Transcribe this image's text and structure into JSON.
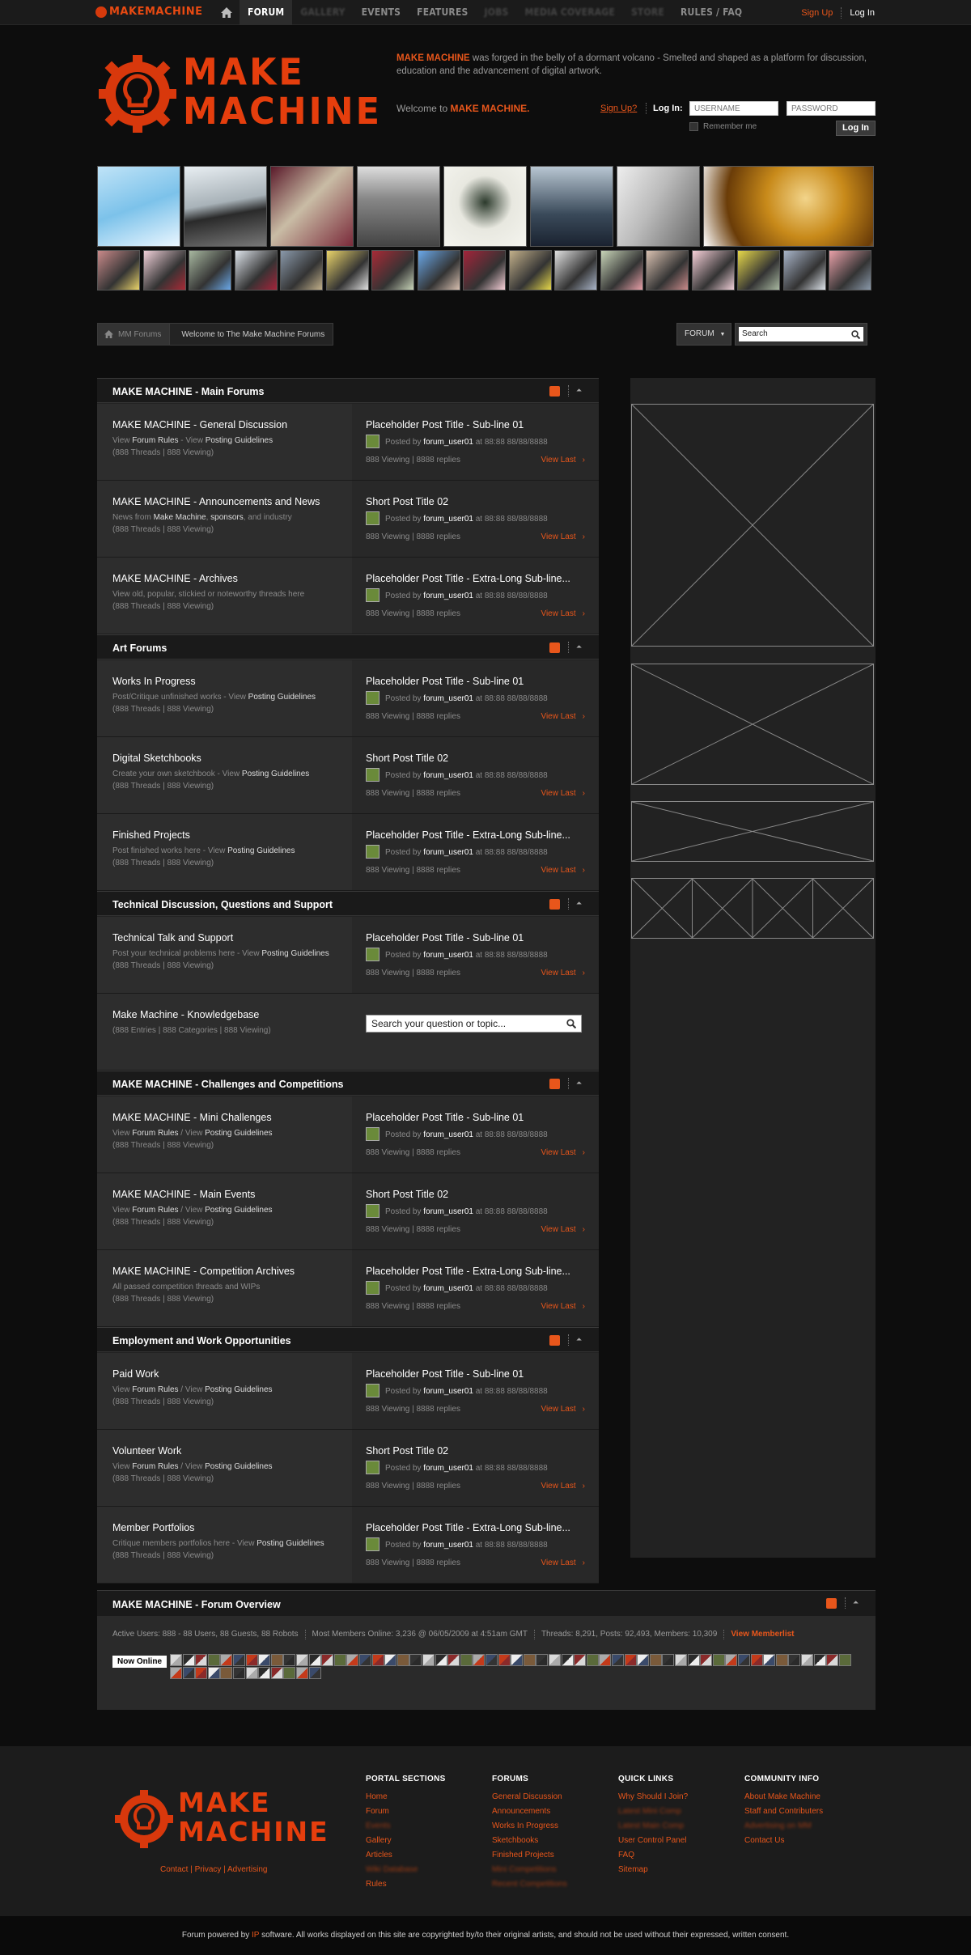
{
  "topnav": {
    "logo_text": "MAKEMACHINE",
    "items": [
      {
        "label": "FORUM",
        "active": true
      },
      {
        "label": "GALLERY",
        "blur": true
      },
      {
        "label": "EVENTS"
      },
      {
        "label": "FEATURES"
      },
      {
        "label": "JOBS",
        "blur": true
      },
      {
        "label": "MEDIA COVERAGE",
        "blur": true
      },
      {
        "label": "STORE",
        "blur": true
      },
      {
        "label": "RULES / FAQ"
      }
    ],
    "signup": "Sign Up",
    "login": "Log In"
  },
  "header": {
    "logo_line1": "MAKE",
    "logo_line2": "MACHINE",
    "intro_brand": "MAKE MACHINE",
    "intro_text": " was forged in the belly of a dormant volcano - Smelted and shaped as a platform for discussion, education and the advancement of digital artwork.",
    "welcome_prefix": "Welcome to ",
    "welcome_brand": "MAKE MACHINE."
  },
  "login": {
    "signup": "Sign Up?",
    "label": "Log In:",
    "username_placeholder": "USERNAME",
    "password_placeholder": "PASSWORD",
    "remember": "Remember me",
    "button": "Log In"
  },
  "breadcrumb": {
    "home": "MM Forums",
    "current": "Welcome to The Make Machine Forums"
  },
  "forum_search": {
    "dropdown": "FORUM",
    "placeholder": "Search"
  },
  "categories": [
    {
      "title": "MAKE MACHINE - Main Forums"
    },
    {
      "title": "Art Forums"
    },
    {
      "title": "Technical Discussion, Questions and Support"
    },
    {
      "title": "MAKE MACHINE - Challenges and Competitions"
    },
    {
      "title": "Employment and Work Opportunities"
    }
  ],
  "forums": [
    {
      "title": "MAKE MACHINE - General Discussion",
      "desc_a": "View ",
      "desc_b": "Forum Rules",
      "desc_c": " - View ",
      "desc_d": "Posting Guidelines",
      "stats": "(888 Threads | 888 Viewing)",
      "post": "Placeholder Post Title - Sub-line 01"
    },
    {
      "title": "MAKE MACHINE - Announcements and News",
      "desc_a": "News from ",
      "desc_b": "Make Machine",
      "desc_c": ", ",
      "desc_d": "sponsors",
      "desc_e": ", and industry",
      "stats": "(888 Threads | 888 Viewing)",
      "post": "Short Post Title 02"
    },
    {
      "title": "MAKE MACHINE - Archives",
      "desc_a": "View old, popular, stickied or noteworthy threads here",
      "stats": "(888 Threads | 888 Viewing)",
      "post": "Placeholder Post Title - Extra-Long Sub-line..."
    },
    {
      "title": "Works In Progress",
      "desc_a": "Post/Critique unfinished works - View ",
      "desc_d": "Posting Guidelines",
      "stats": "(888 Threads | 888 Viewing)",
      "post": "Placeholder Post Title - Sub-line 01"
    },
    {
      "title": "Digital Sketchbooks",
      "desc_a": "Create your own sketchbook - View ",
      "desc_d": "Posting Guidelines",
      "stats": "(888 Threads | 888 Viewing)",
      "post": "Short Post Title 02"
    },
    {
      "title": "Finished Projects",
      "desc_a": "Post finished works here - View ",
      "desc_d": "Posting Guidelines",
      "stats": "(888 Threads | 888 Viewing)",
      "post": "Placeholder Post Title - Extra-Long Sub-line..."
    },
    {
      "title": "Technical Talk and Support",
      "desc_a": "Post your technical problems here - View ",
      "desc_d": "Posting Guidelines",
      "stats": "(888 Threads | 888 Viewing)",
      "post": "Placeholder Post Title - Sub-line 01"
    },
    {
      "title": "Make Machine - Knowledgebase",
      "stats": "(888 Entries | 888 Categories | 888 Viewing)",
      "kb_placeholder": "Search your question or topic..."
    },
    {
      "title": "MAKE MACHINE - Mini Challenges",
      "desc_a": "View ",
      "desc_b": "Forum Rules",
      "desc_c": " / View ",
      "desc_d": "Posting Guidelines",
      "stats": "(888 Threads | 888 Viewing)",
      "post": "Placeholder Post Title - Sub-line 01"
    },
    {
      "title": "MAKE MACHINE - Main Events",
      "desc_a": "View ",
      "desc_b": "Forum Rules",
      "desc_c": " / View ",
      "desc_d": "Posting Guidelines",
      "stats": "(888 Threads | 888 Viewing)",
      "post": "Short Post Title 02"
    },
    {
      "title": "MAKE MACHINE - Competition Archives",
      "desc_a": "All passed competition threads and WIPs",
      "stats": "(888 Threads | 888 Viewing)",
      "post": "Placeholder Post Title - Extra-Long Sub-line..."
    },
    {
      "title": "Paid Work",
      "desc_a": "View ",
      "desc_b": "Forum Rules",
      "desc_c": " / View ",
      "desc_d": "Posting Guidelines",
      "stats": "(888 Threads | 888 Viewing)",
      "post": "Placeholder Post Title - Sub-line 01"
    },
    {
      "title": "Volunteer Work",
      "desc_a": "View ",
      "desc_b": "Forum Rules",
      "desc_c": " / View ",
      "desc_d": "Posting Guidelines",
      "stats": "(888 Threads | 888 Viewing)",
      "post": "Short Post Title 02"
    },
    {
      "title": "Member Portfolios",
      "desc_a": "Critique members portfolios here - View ",
      "desc_d": "Posting Guidelines",
      "stats": "(888 Threads | 888 Viewing)",
      "post": "Placeholder Post Title - Extra-Long Sub-line..."
    }
  ],
  "post_meta": {
    "posted_by": "Posted by ",
    "user": "forum_user01",
    "at": " at 88:88 88/88/8888",
    "viewing": "888 Viewing | 8888 replies",
    "view_last": "View Last",
    "arrow": "›"
  },
  "overview": {
    "title": "MAKE MACHINE - Forum Overview",
    "active": "Active Users: 888 - 88 Users, 88 Guests, 88 Robots",
    "most": "Most Members Online: 3,236 @ 06/05/2009 at 4:51am GMT",
    "threads": "Threads: 8,291, Posts: 92,493, Members: 10,309",
    "memberlist": "View Memberlist",
    "now_online": "Now Online"
  },
  "footer": {
    "links": "Contact | Privacy | Advertising",
    "columns": [
      {
        "heading": "PORTAL SECTIONS",
        "links": [
          {
            "t": "Home"
          },
          {
            "t": "Forum"
          },
          {
            "t": "Events",
            "blur": true
          },
          {
            "t": "Gallery"
          },
          {
            "t": "Articles"
          },
          {
            "t": "Wiki Database",
            "blur": true
          },
          {
            "t": "Rules"
          }
        ]
      },
      {
        "heading": "FORUMS",
        "links": [
          {
            "t": "General Discussion"
          },
          {
            "t": "Announcements"
          },
          {
            "t": "Works In Progress"
          },
          {
            "t": "Sketchbooks"
          },
          {
            "t": "Finished Projects"
          },
          {
            "t": "Mini Competitions",
            "blur": true
          },
          {
            "t": "Recent Competitions",
            "blur": true
          }
        ]
      },
      {
        "heading": "QUICK LINKS",
        "links": [
          {
            "t": "Why Should I Join?"
          },
          {
            "t": "Latest Mini Comp",
            "blur": true
          },
          {
            "t": "Latest Main Comp",
            "blur": true
          },
          {
            "t": "User Control Panel"
          },
          {
            "t": "FAQ"
          },
          {
            "t": "Sitemap"
          }
        ]
      },
      {
        "heading": "COMMUNITY INFO",
        "links": [
          {
            "t": "About Make Machine"
          },
          {
            "t": "Staff and Contributers"
          },
          {
            "t": "Advertising on MM",
            "blur": true
          },
          {
            "t": "Contact Us"
          }
        ]
      }
    ]
  },
  "copyright": {
    "pre": "Forum powered by ",
    "brand": "IP",
    "post": " software. All works displayed on this site are copyrighted by/to their original artists, and should not be used without their expressed, written consent."
  },
  "colors": {
    "accent": "#e8561b",
    "bg": "#0d0d0d",
    "panel": "#2d2d2d"
  }
}
